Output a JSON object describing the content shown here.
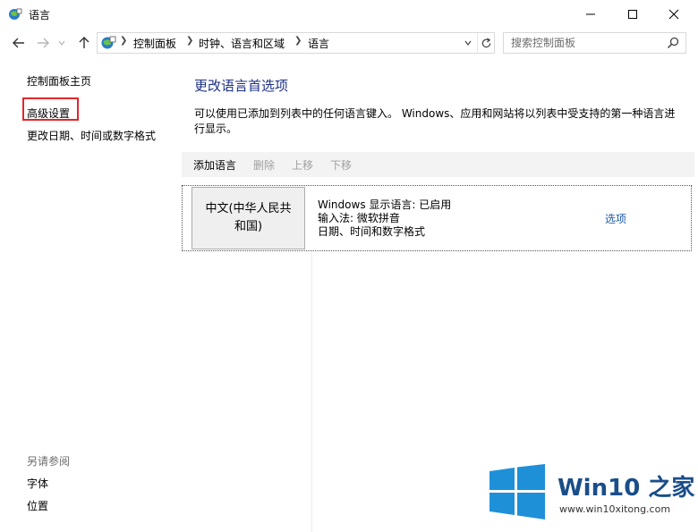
{
  "window": {
    "title": "语言"
  },
  "address": {
    "crumbs": [
      "控制面板",
      "时钟、语言和区域",
      "语言"
    ]
  },
  "search": {
    "placeholder": "搜索控制面板"
  },
  "left_pane": {
    "home": "控制面板主页",
    "advanced": "高级设置",
    "date_format": "更改日期、时间或数字格式",
    "see_also": "另请参阅",
    "fonts": "字体",
    "location": "位置"
  },
  "main": {
    "title": "更改语言首选项",
    "description": "可以使用已添加到列表中的任何语言键入。 Windows、应用和网站将以列表中受支持的第一种语言进行显示。",
    "toolbar": {
      "add": "添加语言",
      "remove": "删除",
      "up": "上移",
      "down": "下移"
    },
    "language": {
      "name": "中文(中华人民共和国)",
      "display_lang": "Windows 显示语言: 已启用",
      "input_method": "输入法: 微软拼音",
      "date_format": "日期、时间和数字格式",
      "options": "选项"
    }
  },
  "watermark": {
    "brand": "Win10 之家",
    "url": "www.win10xitong.com"
  },
  "colors": {
    "link": "#1e3287",
    "highlight": "#e0272b",
    "logo_blue": "#1e90d8"
  }
}
